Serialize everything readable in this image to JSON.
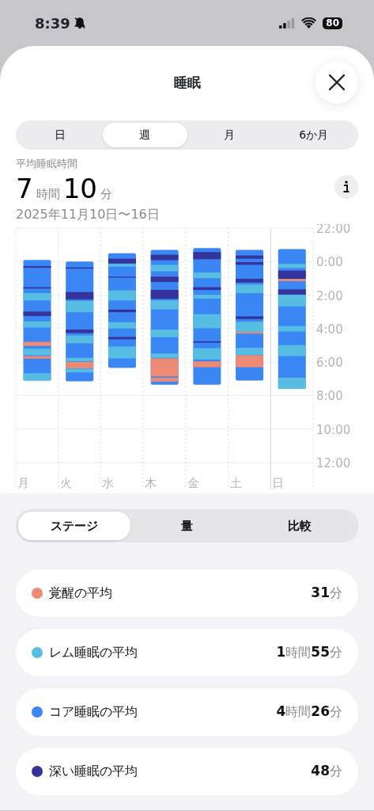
{
  "status_bar": {
    "time": "8:39",
    "battery": "80"
  },
  "title": "睡眠",
  "period_tabs": [
    {
      "label": "日",
      "selected": false
    },
    {
      "label": "週",
      "selected": true
    },
    {
      "label": "月",
      "selected": false
    },
    {
      "label": "6か月",
      "selected": false
    }
  ],
  "summary": {
    "label": "平均睡眠時間",
    "hours": "7",
    "hours_unit": "時間",
    "minutes": "10",
    "minutes_unit": "分",
    "date_range": "2025年11月10日〜16日"
  },
  "chart": {
    "time_labels": [
      "22:00",
      "0:00",
      "2:00",
      "4:00",
      "6:00",
      "8:00",
      "10:00",
      "12:00"
    ],
    "day_labels": [
      "月",
      "火",
      "水",
      "木",
      "金",
      "土",
      "日"
    ]
  },
  "view_tabs": [
    {
      "label": "ステージ",
      "selected": true
    },
    {
      "label": "量",
      "selected": false
    },
    {
      "label": "比較",
      "selected": false
    }
  ],
  "stages": [
    {
      "label": "覚醒の平均",
      "color": "#ec8a73",
      "value": "**31**分"
    },
    {
      "label": "レム睡眠の平均",
      "color": "#57bde2",
      "value": "**1**時間**55**分"
    },
    {
      "label": "コア睡眠の平均",
      "color": "#3b86f5",
      "value": "**4**時間**26**分"
    },
    {
      "label": "深い睡眠の平均",
      "color": "#35339c",
      "value": "**48**分"
    }
  ]
}
